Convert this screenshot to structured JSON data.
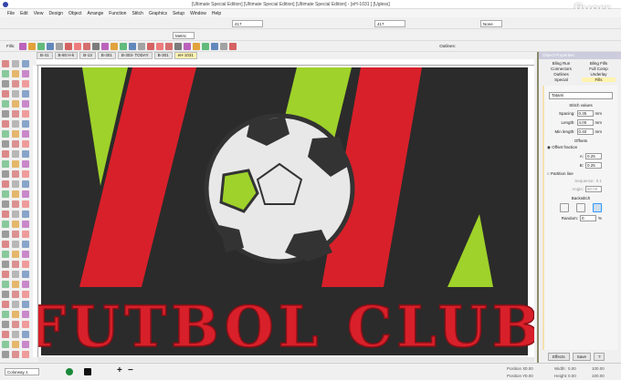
{
  "window": {
    "title": "[Ultimate Special Edition] [Ultimate Special Edition] [Ultimate Special Edition] - [eH-1031     ]  [Ugless]",
    "watermark": "fiverr."
  },
  "menu": [
    "File",
    "Edit",
    "View",
    "Design",
    "Object",
    "Arrange",
    "Function",
    "Stitch",
    "Graphics",
    "Setup",
    "Window",
    "Help"
  ],
  "toolbar": {
    "zoom_value": "417",
    "units": "Metric",
    "none_select": "None",
    "fills_label": "Fills:",
    "outlines_label": "Outlines:"
  },
  "design_tabs": [
    "B-41",
    "B-80 H-k",
    "B-13",
    "B-301",
    "B-303- TODAY",
    "B-301",
    "eH-1031"
  ],
  "panel": {
    "title": "Object Properties",
    "tabs": [
      "Bling Run",
      "Bling Fills",
      "Connectors",
      "Full Comp",
      "Outlines",
      "Underlay",
      "Special",
      "Fills"
    ],
    "fill_type": "Tatami",
    "stitch_values": "Stitch values",
    "spacing_label": "Spacing:",
    "spacing": "0.35",
    "length_label": "Length:",
    "length": "4.00",
    "minlen_label": "Min length:",
    "minlen": "0.40",
    "unit": "mm",
    "offsets": "Offsets",
    "offset_fraction": "Offset fraction",
    "a_label": "A:",
    "a": "0.25",
    "b_label": "B:",
    "b": "0.25",
    "fraction_line": "Partition line",
    "sequence_label": "Sequence:",
    "sequence": "0.1",
    "angle_label": "Angle:",
    "angle": "90.00",
    "backstitch": "Backstitch",
    "random_label": "Random:",
    "random": "0",
    "percent": "%",
    "effects": "Effects",
    "save": "Save",
    "help": "?"
  },
  "design": {
    "text": "FUTBOL CLUB",
    "colors": {
      "red": "#d8202a",
      "green": "#9fd22a",
      "canvas": "#2b2b2b",
      "ball_white": "#e8e8e8",
      "ball_black": "#333333"
    }
  },
  "status": {
    "colorway": "Colorway 1",
    "position_x_label": "Position X:",
    "position_y_label": "Position Y:",
    "x": "0.00",
    "y": "0.00",
    "width_label": "Width:",
    "height_label": "Height:",
    "w": "0.00",
    "h": "0.00",
    "wpct": "100.00",
    "hpct": "100.00"
  }
}
